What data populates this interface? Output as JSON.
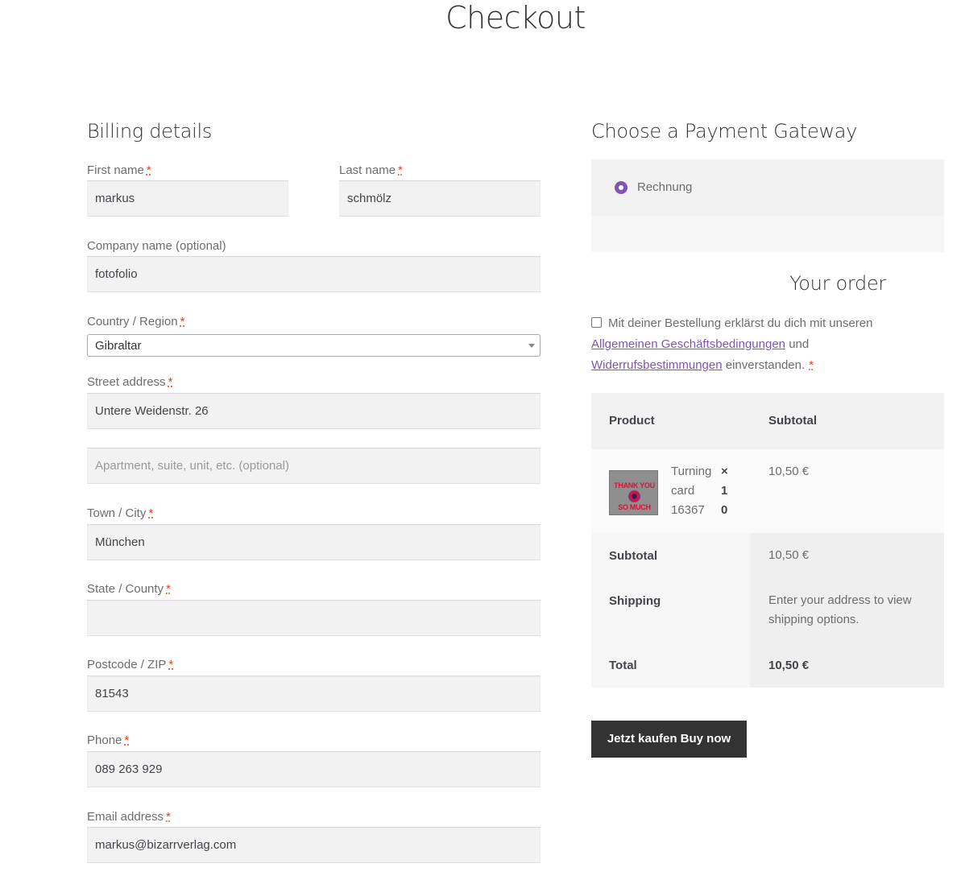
{
  "page": {
    "title": "Checkout"
  },
  "billing": {
    "heading": "Billing details",
    "required_mark": "*",
    "first_name": {
      "label": "First name",
      "value": "markus"
    },
    "last_name": {
      "label": "Last name",
      "value": "schmölz"
    },
    "company": {
      "label": "Company name (optional)",
      "value": "fotofolio"
    },
    "country": {
      "label": "Country / Region",
      "value": "Gibraltar"
    },
    "street": {
      "label": "Street address",
      "value": "Untere Weidenstr. 26",
      "placeholder2": "Apartment, suite, unit, etc. (optional)"
    },
    "city": {
      "label": "Town / City",
      "value": "München"
    },
    "state": {
      "label": "State / County",
      "value": ""
    },
    "postcode": {
      "label": "Postcode / ZIP",
      "value": "81543"
    },
    "phone": {
      "label": "Phone",
      "value": "089 263 929"
    },
    "email": {
      "label": "Email address",
      "value": "markus@bizarrverlag.com"
    }
  },
  "payment": {
    "heading": "Choose a Payment Gateway",
    "gateway_label": "Rechnung",
    "accent_color": "#7f54b3"
  },
  "order": {
    "heading": "Your order",
    "terms": {
      "prefix": "Mit deiner Bestellung erklärst du dich mit unseren",
      "link1": "Allgemeinen Geschäftsbedingungen",
      "mid": "und",
      "link2": "Widerrufsbestimmungen",
      "suffix": "einverstanden.",
      "required_mark": "*"
    },
    "table": {
      "col_product": "Product",
      "col_subtotal": "Subtotal",
      "item": {
        "name_lines": [
          "Turning",
          "card",
          "16367"
        ],
        "qty_lines": [
          "×",
          "1",
          "0"
        ],
        "subtotal": "10,50 €",
        "thumb_text_top": "THANK YOU",
        "thumb_text_bottom": "SO MUCH"
      },
      "subtotal_label": "Subtotal",
      "subtotal_value": "10,50 €",
      "shipping_label": "Shipping",
      "shipping_value_lines": [
        "Enter your address to view",
        "shipping options."
      ],
      "total_label": "Total",
      "total_value": "10,50 €"
    },
    "buy_button": "Jetzt kaufen Buy now"
  }
}
